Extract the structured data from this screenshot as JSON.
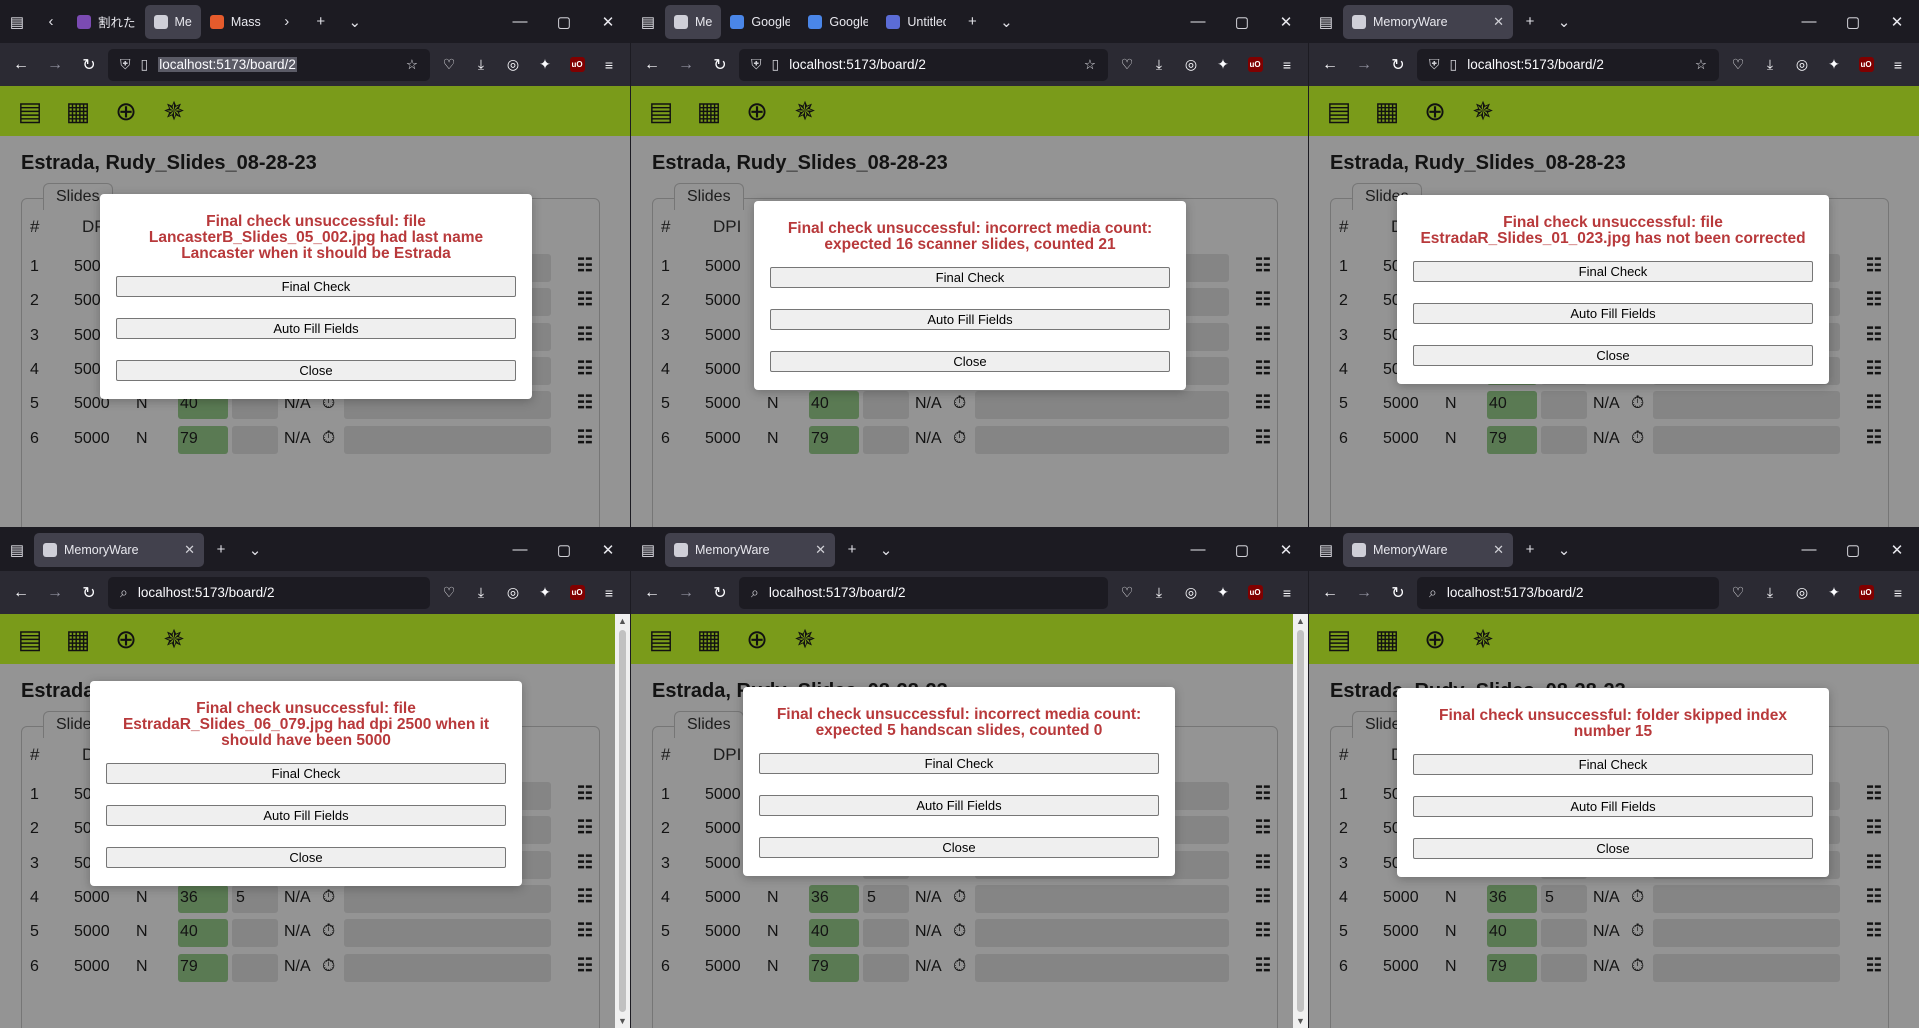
{
  "board_title": "Estrada, Rudy_Slides_08-28-23",
  "slides_tab": "Slides",
  "columns": [
    "#",
    "DPI"
  ],
  "dialog_buttons": {
    "final_check": "Final Check",
    "auto_fill": "Auto Fill Fields",
    "close": "Close"
  },
  "rows": [
    {
      "num": "1",
      "dpi": "5000",
      "n": "",
      "count": "",
      "extra": "",
      "na": ""
    },
    {
      "num": "2",
      "dpi": "5000",
      "n": "",
      "count": "",
      "extra": "",
      "na": ""
    },
    {
      "num": "3",
      "dpi": "5000",
      "n": "",
      "count": "",
      "extra": "",
      "na": ""
    },
    {
      "num": "4",
      "dpi": "5000",
      "n": "N",
      "count": "36",
      "extra": "5",
      "na": "N/A"
    },
    {
      "num": "5",
      "dpi": "5000",
      "n": "N",
      "count": "40",
      "extra": "",
      "na": "N/A"
    },
    {
      "num": "6",
      "dpi": "5000",
      "n": "N",
      "count": "79",
      "extra": "",
      "na": "N/A"
    }
  ],
  "windows": [
    {
      "tabs": [
        {
          "label": "割れた",
          "color": "#7b4bb3",
          "active": false
        },
        {
          "label": "Me",
          "color": "#cfcfd8",
          "active": true
        },
        {
          "label": "Mass",
          "color": "#e55b2c",
          "active": false
        }
      ],
      "url": "localhost:5173/board/2",
      "url_selected": true,
      "message": "Final check unsuccessful: file LancasterB_Slides_05_002.jpg had last name Lancaster when it should be Estrada"
    },
    {
      "tabs": [
        {
          "label": "Me",
          "color": "#cfcfd8",
          "active": true
        },
        {
          "label": "Google",
          "color": "#4a86e8",
          "active": false
        },
        {
          "label": "Google",
          "color": "#4a86e8",
          "active": false
        },
        {
          "label": "Untitled",
          "color": "#5b6cd6",
          "active": false
        }
      ],
      "url": "localhost:5173/board/2",
      "url_selected": false,
      "message": "Final check unsuccessful: incorrect media count: expected 16 scanner slides, counted 21"
    },
    {
      "tabs": [
        {
          "label": "MemoryWare",
          "color": "#cfcfd8",
          "active": true
        }
      ],
      "url": "localhost:5173/board/2",
      "url_selected": false,
      "message": "Final check unsuccessful: file EstradaR_Slides_01_023.jpg has not been corrected"
    },
    {
      "tabs": [
        {
          "label": "MemoryWare",
          "color": "#cfcfd8",
          "active": true
        }
      ],
      "url": "localhost:5173/board/2",
      "url_selected": false,
      "message": "Final check unsuccessful: file EstradaR_Slides_06_079.jpg had dpi 2500 when it should have been 5000"
    },
    {
      "tabs": [
        {
          "label": "MemoryWare",
          "color": "#cfcfd8",
          "active": true
        }
      ],
      "url": "localhost:5173/board/2",
      "url_selected": false,
      "message": "Final check unsuccessful: incorrect media count: expected 5 handscan slides, counted 0"
    },
    {
      "tabs": [
        {
          "label": "MemoryWare",
          "color": "#cfcfd8",
          "active": true
        }
      ],
      "url": "localhost:5173/board/2",
      "url_selected": false,
      "message": "Final check unsuccessful: folder skipped index number 15"
    }
  ]
}
